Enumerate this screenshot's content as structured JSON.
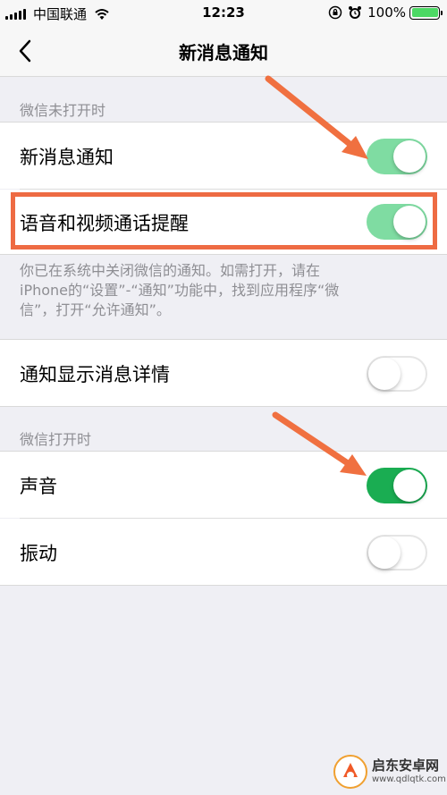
{
  "status_bar": {
    "carrier": "中国联通",
    "time": "12:23",
    "battery_percent": "100%",
    "battery_color": "#4cd964"
  },
  "nav": {
    "back_icon": "chevron-left-icon",
    "title": "新消息通知"
  },
  "sections": [
    {
      "header": "微信未打开时",
      "items": [
        {
          "label": "新消息通知",
          "toggle": "on",
          "toggle_color": "#7fdca2"
        },
        {
          "label": "语音和视频通话提醒",
          "toggle": "on",
          "toggle_color": "#7fdca2"
        }
      ],
      "footnote_line1": "你已在系统中关闭微信的通知。如需打开，请在",
      "footnote_line2": "iPhone的“设置”-“通知”功能中，找到应用程序“微",
      "footnote_line3": "信”，打开“允许通知”。"
    },
    {
      "items": [
        {
          "label": "通知显示消息详情",
          "toggle": "off"
        }
      ]
    },
    {
      "header": "微信打开时",
      "items": [
        {
          "label": "声音",
          "toggle": "on",
          "toggle_color": "#1aad52"
        },
        {
          "label": "振动",
          "toggle": "off"
        }
      ]
    }
  ],
  "annotations": {
    "highlight_color": "#ee6b43",
    "arrow_color": "#f07040"
  },
  "watermark": {
    "text": "启东安卓网",
    "url": "www.qdlqtk.com"
  }
}
